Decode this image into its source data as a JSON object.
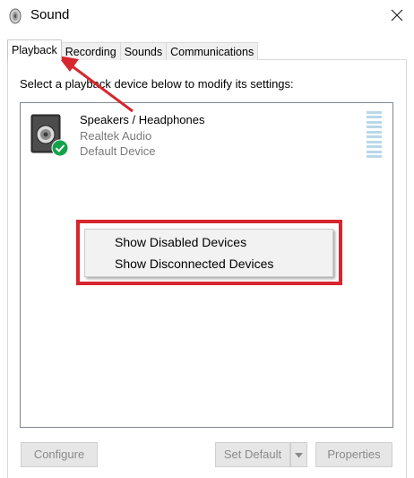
{
  "window": {
    "title": "Sound"
  },
  "tabs": [
    {
      "label": "Playback"
    },
    {
      "label": "Recording"
    },
    {
      "label": "Sounds"
    },
    {
      "label": "Communications"
    }
  ],
  "playback": {
    "instruction": "Select a playback device below to modify its settings:",
    "devices": [
      {
        "name": "Speakers / Headphones",
        "driver": "Realtek Audio",
        "status": "Default Device",
        "icon": "speaker-icon",
        "badge": "green-check-icon"
      }
    ],
    "context_menu": [
      {
        "label": "Show Disabled Devices"
      },
      {
        "label": "Show Disconnected Devices"
      }
    ]
  },
  "buttons": {
    "configure": "Configure",
    "set_default": "Set Default",
    "properties": "Properties"
  },
  "colors": {
    "annotation": "#d7262d",
    "check": "#12a34a",
    "meter": "#b9d8ea"
  }
}
